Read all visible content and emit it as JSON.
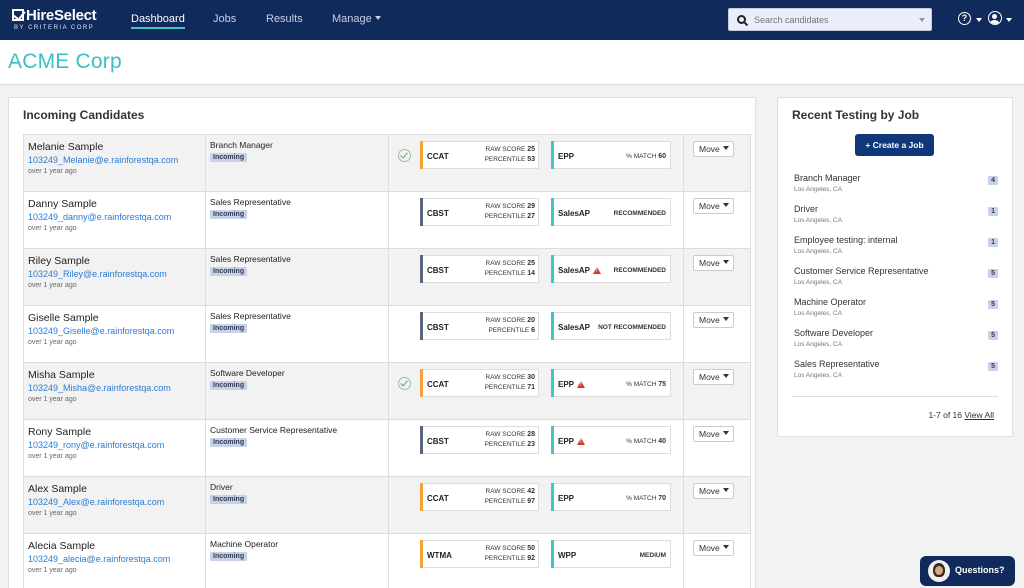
{
  "brand": {
    "name": "HireSelect",
    "sub": "BY CRITERIA CORP"
  },
  "nav": {
    "dashboard": "Dashboard",
    "jobs": "Jobs",
    "results": "Results",
    "manage": "Manage"
  },
  "search": {
    "placeholder": "Search candidates"
  },
  "help_icon_label": "?",
  "company": "ACME Corp",
  "incoming": {
    "title": "Incoming Candidates",
    "move_label": "Move",
    "candidates": [
      {
        "name": "Melanie Sample",
        "email": "103249_Melanie@e.rainforestqa.com",
        "time": "over 1 year ago",
        "job": "Branch Manager",
        "status": "Incoming",
        "checked": true,
        "t1": {
          "test": "CCAT",
          "raw_label": "RAW SCORE",
          "raw": "25",
          "pct_label": "PERCENTILE",
          "pct": "53",
          "color": "#f3a435"
        },
        "t2": {
          "test": "EPP",
          "warn": false,
          "kind": "match",
          "label": "% MATCH",
          "value": "60",
          "color": "#3ec7c9"
        }
      },
      {
        "name": "Danny Sample",
        "email": "103249_danny@e.rainforestqa.com",
        "time": "over 1 year ago",
        "job": "Sales Representative",
        "status": "Incoming",
        "checked": false,
        "t1": {
          "test": "CBST",
          "raw_label": "RAW SCORE",
          "raw": "29",
          "pct_label": "PERCENTILE",
          "pct": "27",
          "color": "#57657d"
        },
        "t2": {
          "test": "SalesAP",
          "warn": false,
          "kind": "rec",
          "label": "RECOMMENDED",
          "value": "",
          "color": "#3ec7c9"
        }
      },
      {
        "name": "Riley Sample",
        "email": "103249_Riley@e.rainforestqa.com",
        "time": "over 1 year ago",
        "job": "Sales Representative",
        "status": "Incoming",
        "checked": false,
        "t1": {
          "test": "CBST",
          "raw_label": "RAW SCORE",
          "raw": "25",
          "pct_label": "PERCENTILE",
          "pct": "14",
          "color": "#57657d"
        },
        "t2": {
          "test": "SalesAP",
          "warn": true,
          "kind": "rec",
          "label": "RECOMMENDED",
          "value": "",
          "color": "#3ec7c9"
        }
      },
      {
        "name": "Giselle Sample",
        "email": "103249_Giselle@e.rainforestqa.com",
        "time": "over 1 year ago",
        "job": "Sales Representative",
        "status": "Incoming",
        "checked": false,
        "t1": {
          "test": "CBST",
          "raw_label": "RAW SCORE",
          "raw": "20",
          "pct_label": "PERCENTILE",
          "pct": "6",
          "color": "#57657d"
        },
        "t2": {
          "test": "SalesAP",
          "warn": false,
          "kind": "rec",
          "label": "NOT RECOMMENDED",
          "value": "",
          "color": "#3ec7c9"
        }
      },
      {
        "name": "Misha Sample",
        "email": "103249_Misha@e.rainforestqa.com",
        "time": "over 1 year ago",
        "job": "Software Developer",
        "status": "Incoming",
        "checked": true,
        "t1": {
          "test": "CCAT",
          "raw_label": "RAW SCORE",
          "raw": "30",
          "pct_label": "PERCENTILE",
          "pct": "71",
          "color": "#f3a435"
        },
        "t2": {
          "test": "EPP",
          "warn": true,
          "kind": "match",
          "label": "% MATCH",
          "value": "75",
          "color": "#3ec7c9"
        }
      },
      {
        "name": "Rony Sample",
        "email": "103249_rony@e.rainforestqa.com",
        "time": "over 1 year ago",
        "job": "Customer Service Representative",
        "status": "Incoming",
        "checked": false,
        "t1": {
          "test": "CBST",
          "raw_label": "RAW SCORE",
          "raw": "28",
          "pct_label": "PERCENTILE",
          "pct": "23",
          "color": "#57657d"
        },
        "t2": {
          "test": "EPP",
          "warn": true,
          "kind": "match",
          "label": "% MATCH",
          "value": "40",
          "color": "#3ec7c9"
        }
      },
      {
        "name": "Alex Sample",
        "email": "103249_Alex@e.rainforestqa.com",
        "time": "over 1 year ago",
        "job": "Driver",
        "status": "Incoming",
        "checked": false,
        "t1": {
          "test": "CCAT",
          "raw_label": "RAW SCORE",
          "raw": "42",
          "pct_label": "PERCENTILE",
          "pct": "97",
          "color": "#f3a435"
        },
        "t2": {
          "test": "EPP",
          "warn": false,
          "kind": "match",
          "label": "% MATCH",
          "value": "70",
          "color": "#3ec7c9"
        }
      },
      {
        "name": "Alecia Sample",
        "email": "103249_alecia@e.rainforestqa.com",
        "time": "over 1 year ago",
        "job": "Machine Operator",
        "status": "Incoming",
        "checked": false,
        "t1": {
          "test": "WTMA",
          "raw_label": "RAW SCORE",
          "raw": "50",
          "pct_label": "PERCENTILE",
          "pct": "92",
          "color": "#f3a435"
        },
        "t2": {
          "test": "WPP",
          "warn": false,
          "kind": "rec",
          "label": "MEDIUM",
          "value": "",
          "color": "#3ec7c9"
        }
      }
    ]
  },
  "recent": {
    "title": "Recent Testing by Job",
    "create_label": "+ Create a Job",
    "jobs": [
      {
        "title": "Branch Manager",
        "location": "Los Angeles, CA",
        "count": "4"
      },
      {
        "title": "Driver",
        "location": "Los Angeles, CA",
        "count": "1"
      },
      {
        "title": "Employee testing: internal",
        "location": "Los Angeles, CA",
        "count": "1"
      },
      {
        "title": "Customer Service Representative",
        "location": "Los Angeles, CA",
        "count": "5"
      },
      {
        "title": "Machine Operator",
        "location": "Los Angeles, CA",
        "count": "5"
      },
      {
        "title": "Software Developer",
        "location": "Los Angeles, CA",
        "count": "5"
      },
      {
        "title": "Sales Representative",
        "location": "Los Angeles, CA",
        "count": "5"
      }
    ],
    "pager_text": "1-7 of 16",
    "view_all": "View All"
  },
  "questions": "Questions?"
}
